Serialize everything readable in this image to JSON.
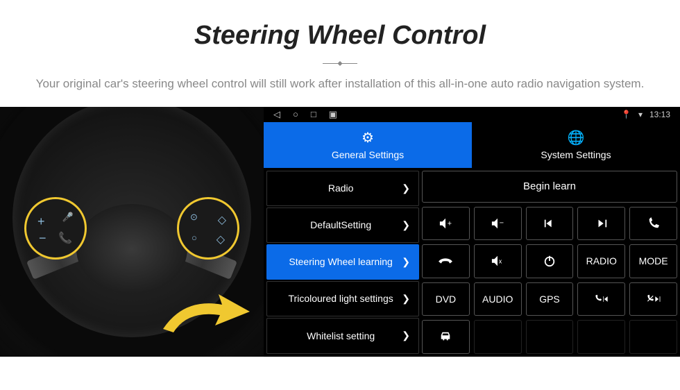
{
  "header": {
    "title": "Steering Wheel Control",
    "subtitle": "Your original car's steering wheel control will still work after installation of this all-in-one auto radio navigation system."
  },
  "status_bar": {
    "time": "13:13"
  },
  "tabs": {
    "general": "General Settings",
    "system": "System Settings"
  },
  "menu": {
    "items": [
      "Radio",
      "DefaultSetting",
      "Steering Wheel learning",
      "Tricoloured light settings",
      "Whitelist setting"
    ]
  },
  "actions": {
    "begin": "Begin learn"
  },
  "buttons": {
    "radio": "RADIO",
    "mode": "MODE",
    "dvd": "DVD",
    "audio": "AUDIO",
    "gps": "GPS"
  }
}
